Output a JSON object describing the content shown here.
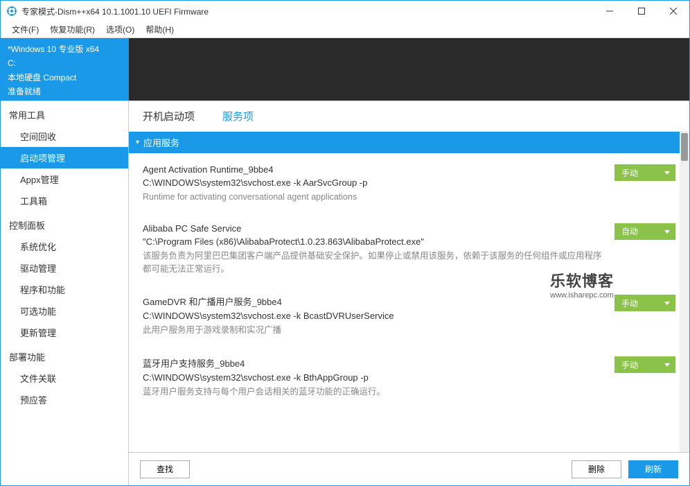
{
  "window": {
    "title": "专家模式-Dism++x64 10.1.1001.10 UEFI Firmware"
  },
  "menu": {
    "file": "文件(F)",
    "recovery": "恢复功能(R)",
    "options": "选项(O)",
    "help": "帮助(H)"
  },
  "info": {
    "os": "*Windows 10 专业版 x64",
    "drive": "C:",
    "disk": "本地硬盘 Compact",
    "status": "准备就绪"
  },
  "sidebar": {
    "groups": [
      {
        "title": "常用工具",
        "items": [
          {
            "label": "空间回收",
            "active": false
          },
          {
            "label": "启动项管理",
            "active": true
          },
          {
            "label": "Appx管理",
            "active": false
          },
          {
            "label": "工具箱",
            "active": false
          }
        ]
      },
      {
        "title": "控制面板",
        "items": [
          {
            "label": "系统优化",
            "active": false
          },
          {
            "label": "驱动管理",
            "active": false
          },
          {
            "label": "程序和功能",
            "active": false
          },
          {
            "label": "可选功能",
            "active": false
          },
          {
            "label": "更新管理",
            "active": false
          }
        ]
      },
      {
        "title": "部署功能",
        "items": [
          {
            "label": "文件关联",
            "active": false
          },
          {
            "label": "预应答",
            "active": false
          }
        ]
      }
    ]
  },
  "tabs": {
    "startup": "开机启动项",
    "services": "服务项"
  },
  "section": {
    "header": "应用服务"
  },
  "services": [
    {
      "name": "Agent Activation Runtime_9bbe4",
      "path": "C:\\WINDOWS\\system32\\svchost.exe -k AarSvcGroup -p",
      "desc": "Runtime for activating conversational agent applications",
      "status": "手动"
    },
    {
      "name": "Alibaba PC Safe Service",
      "path": "\"C:\\Program Files (x86)\\AlibabaProtect\\1.0.23.863\\AlibabaProtect.exe\"",
      "desc": "该服务负责为阿里巴巴集团客户端产品提供基础安全保护。如果停止或禁用该服务，依赖于该服务的任何组件或应用程序都可能无法正常运行。",
      "status": "自动"
    },
    {
      "name": "GameDVR 和广播用户服务_9bbe4",
      "path": "C:\\WINDOWS\\system32\\svchost.exe -k BcastDVRUserService",
      "desc": "此用户服务用于游戏录制和实况广播",
      "status": "手动"
    },
    {
      "name": "蓝牙用户支持服务_9bbe4",
      "path": "C:\\WINDOWS\\system32\\svchost.exe -k BthAppGroup -p",
      "desc": "蓝牙用户服务支持与每个用户会话相关的蓝牙功能的正确运行。",
      "status": "手动"
    }
  ],
  "footer": {
    "find": "查找",
    "delete": "删除",
    "refresh": "刷新"
  },
  "watermark": {
    "main": "乐软博客",
    "sub": "www.isharepc.com"
  }
}
